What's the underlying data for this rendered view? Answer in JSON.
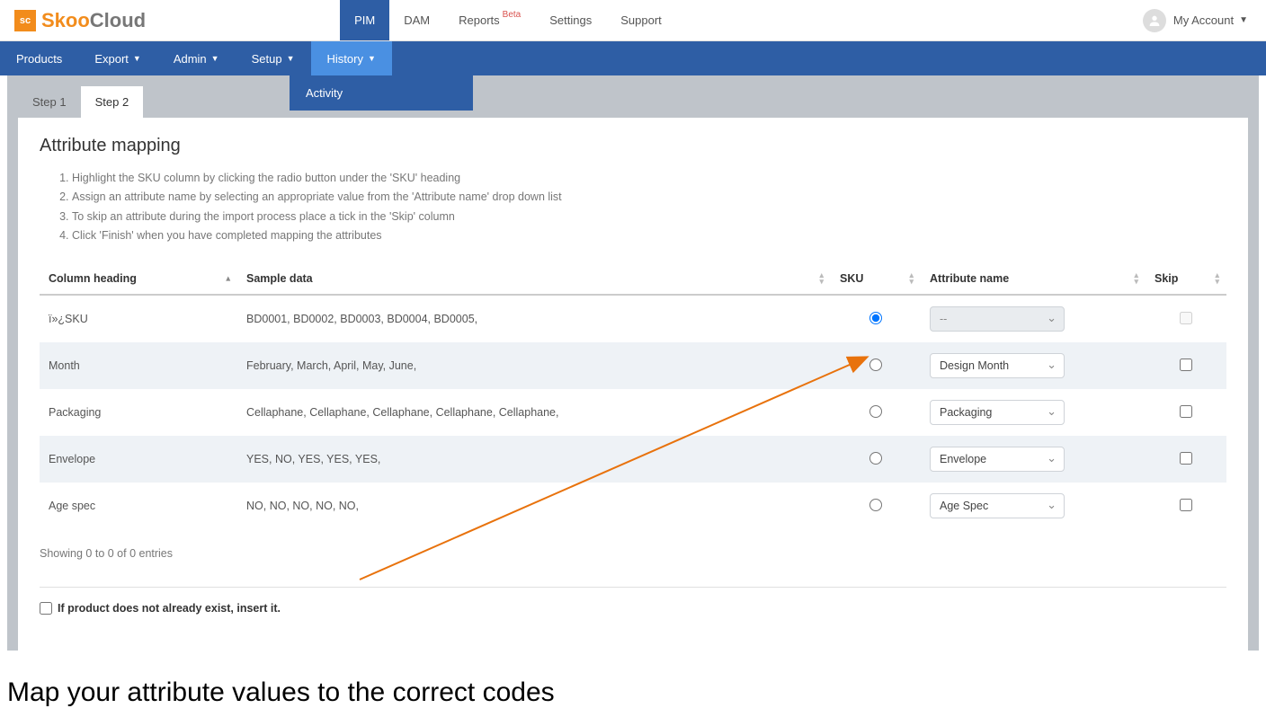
{
  "logo": {
    "sq": "sc",
    "partA": "Skoo",
    "partB": "Cloud"
  },
  "topTabs": {
    "pim": "PIM",
    "dam": "DAM",
    "reports": "Reports",
    "beta": "Beta",
    "settings": "Settings",
    "support": "Support"
  },
  "account": {
    "label": "My Account"
  },
  "nav": {
    "products": "Products",
    "export": "Export",
    "admin": "Admin",
    "setup": "Setup",
    "history": "History"
  },
  "dropdown": {
    "activity": "Activity"
  },
  "pageTabs": {
    "step1": "Step 1",
    "step2": "Step 2"
  },
  "panel": {
    "title": "Attribute mapping",
    "inst1": "Highlight the SKU column by clicking the radio button under the 'SKU' heading",
    "inst2": "Assign an attribute name by selecting an appropriate value from the 'Attribute name' drop down list",
    "inst3": "To skip an attribute during the import process place a tick in the 'Skip' column",
    "inst4": "Click 'Finish' when you have completed mapping the attributes"
  },
  "table": {
    "head": {
      "col": "Column heading",
      "sample": "Sample data",
      "sku": "SKU",
      "attr": "Attribute name",
      "skip": "Skip"
    },
    "rows": [
      {
        "col": "ï»¿SKU",
        "sample": "BD0001, BD0002, BD0003, BD0004, BD0005,",
        "skuChecked": true,
        "attr": "--",
        "attrDisabled": true,
        "skipDisabled": true
      },
      {
        "col": "Month",
        "sample": "February, March, April, May, June,",
        "skuChecked": false,
        "attr": "Design Month",
        "attrDisabled": false,
        "skipDisabled": false
      },
      {
        "col": "Packaging",
        "sample": "Cellaphane, Cellaphane, Cellaphane, Cellaphane, Cellaphane,",
        "skuChecked": false,
        "attr": "Packaging",
        "attrDisabled": false,
        "skipDisabled": false
      },
      {
        "col": "Envelope",
        "sample": "YES, NO, YES, YES, YES,",
        "skuChecked": false,
        "attr": "Envelope",
        "attrDisabled": false,
        "skipDisabled": false
      },
      {
        "col": "Age spec",
        "sample": "NO, NO, NO, NO, NO,",
        "skuChecked": false,
        "attr": "Age Spec",
        "attrDisabled": false,
        "skipDisabled": false
      }
    ],
    "footer": "Showing 0 to 0 of 0 entries"
  },
  "insert": {
    "label": "If product does not already exist, insert it."
  },
  "annotation": {
    "text": "Map your attribute values to the correct codes"
  }
}
